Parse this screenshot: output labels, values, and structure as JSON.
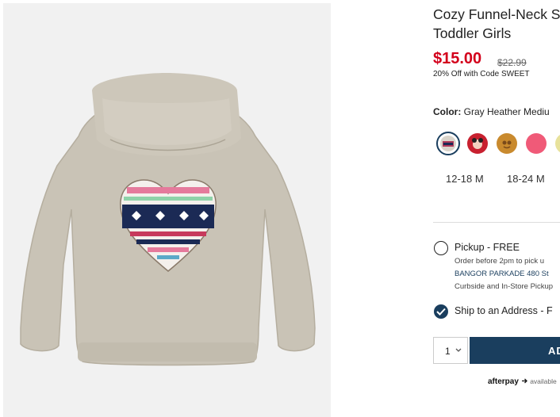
{
  "product": {
    "title_line1": "Cozy Funnel-Neck S",
    "title_line2": "Toddler Girls",
    "price": "$15.00",
    "original_price": "$22.99",
    "promo": "20% Off with Code SWEET"
  },
  "color": {
    "label": "Color:",
    "value": "Gray Heather Mediu",
    "swatches": [
      {
        "name": "gray-fair-isle-heart",
        "selected": true,
        "color": "#d9d4cb"
      },
      {
        "name": "red-character",
        "selected": false,
        "color": "#c8202f"
      },
      {
        "name": "mustard-face",
        "selected": false,
        "color": "#c98a2e"
      },
      {
        "name": "pink",
        "selected": false,
        "color": "#f05a78"
      },
      {
        "name": "yellow",
        "selected": false,
        "color": "#e8e29c"
      }
    ]
  },
  "sizes": [
    "12-18 M",
    "18-24 M"
  ],
  "fulfillment": {
    "pickup_label": "Pickup - FREE",
    "pickup_note": "Order before 2pm to pick u",
    "store": "BANGOR PARKADE 480 St",
    "pickup_options": "Curbside and In-Store Pickup",
    "ship_label": "Ship to an Address - F"
  },
  "cart": {
    "quantity": "1",
    "add_label": "AD"
  },
  "afterpay": {
    "logo": "afterpay",
    "text": "available"
  },
  "colors": {
    "accent_navy": "#1a3e5e",
    "sale_red": "#d3001b"
  }
}
